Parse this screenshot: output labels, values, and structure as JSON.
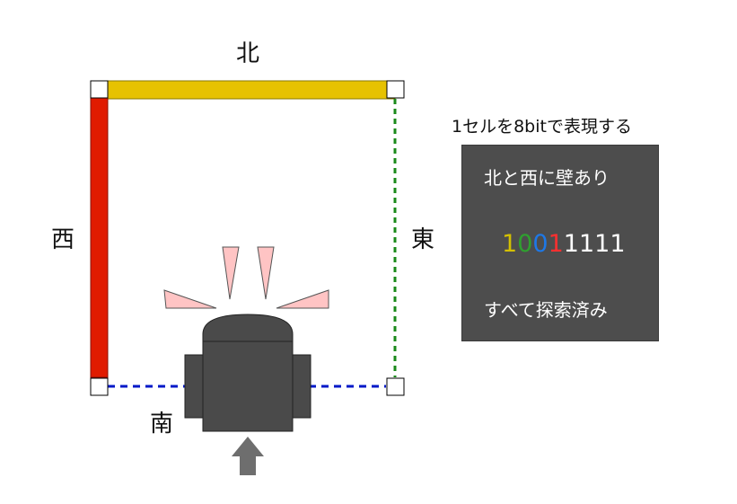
{
  "directions": {
    "north": "北",
    "west": "西",
    "east": "東",
    "south": "南"
  },
  "caption": "1セルを8bitで表現する",
  "panel": {
    "top_text": "北と西に壁あり",
    "bottom_text": "すべて探索済み",
    "bits": [
      "1",
      "0",
      "0",
      "1",
      "1",
      "1",
      "1",
      "1"
    ],
    "bit_colors": [
      "#d4c000",
      "#2fa02f",
      "#1e78e6",
      "#ff3030",
      "#ffffff",
      "#ffffff",
      "#ffffff",
      "#ffffff"
    ]
  },
  "colors": {
    "north_wall": "#e6c200",
    "west_wall": "#e01b00",
    "east_open": "#1a8a1a",
    "south_open": "#0018c8",
    "robot_body": "#4a4a4a",
    "sensor_rays": "#ffc4c4",
    "arrow": "#6e6e6e",
    "panel_bg": "#4d4d4d"
  }
}
